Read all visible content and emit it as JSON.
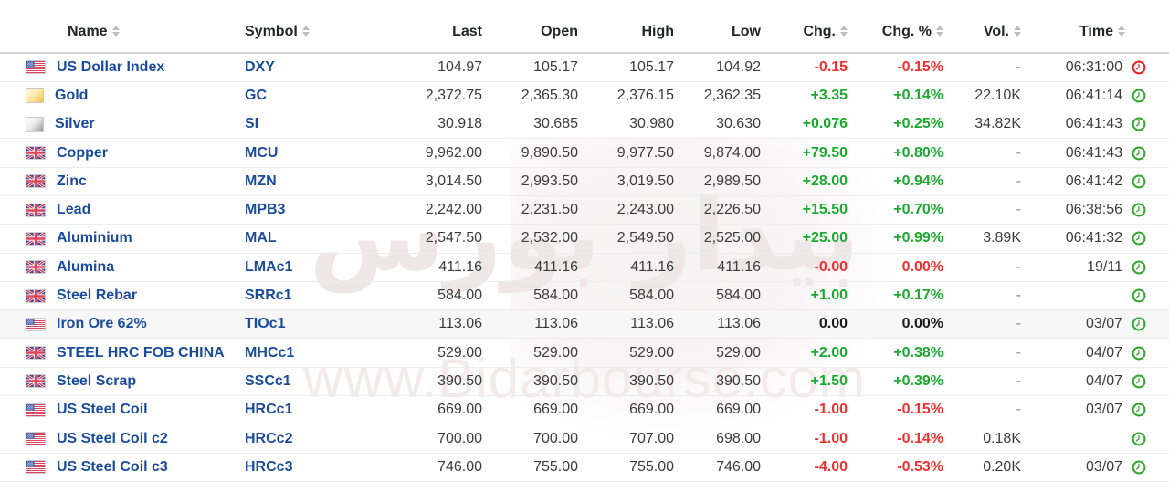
{
  "watermark": {
    "script_text": "بیدار بورس",
    "url_text": "www.Bidarbourse.com"
  },
  "colors": {
    "up": "#19aa2e",
    "down": "#f02f2f",
    "flat": "#1a1a1a",
    "link": "#1a4b9c",
    "header_text": "#232526"
  },
  "table": {
    "columns": [
      {
        "key": "name",
        "label": "Name",
        "align": "left",
        "sortable": true
      },
      {
        "key": "symbol",
        "label": "Symbol",
        "align": "left",
        "sortable": true
      },
      {
        "key": "last",
        "label": "Last",
        "align": "right",
        "sortable": false
      },
      {
        "key": "open",
        "label": "Open",
        "align": "right",
        "sortable": false
      },
      {
        "key": "high",
        "label": "High",
        "align": "right",
        "sortable": false
      },
      {
        "key": "low",
        "label": "Low",
        "align": "right",
        "sortable": false
      },
      {
        "key": "chg",
        "label": "Chg.",
        "align": "right",
        "sortable": true
      },
      {
        "key": "chgpct",
        "label": "Chg. %",
        "align": "right",
        "sortable": true
      },
      {
        "key": "vol",
        "label": "Vol.",
        "align": "right",
        "sortable": true
      },
      {
        "key": "time",
        "label": "Time",
        "align": "right",
        "sortable": true
      }
    ],
    "rows": [
      {
        "icon": "flag-us",
        "name": "US Dollar Index",
        "symbol": "DXY",
        "last": "104.97",
        "open": "105.17",
        "high": "105.17",
        "low": "104.92",
        "chg": "-0.15",
        "chg_dir": "down",
        "chgpct": "-0.15%",
        "chgpct_dir": "down",
        "vol": "-",
        "time": "06:31:00",
        "clock": "clock-red",
        "alt": false
      },
      {
        "icon": "swatch-gold",
        "name": "Gold",
        "symbol": "GC",
        "last": "2,372.75",
        "open": "2,365.30",
        "high": "2,376.15",
        "low": "2,362.35",
        "chg": "+3.35",
        "chg_dir": "up",
        "chgpct": "+0.14%",
        "chgpct_dir": "up",
        "vol": "22.10K",
        "time": "06:41:14",
        "clock": "clock-green",
        "alt": false
      },
      {
        "icon": "swatch-silver",
        "name": "Silver",
        "symbol": "SI",
        "last": "30.918",
        "open": "30.685",
        "high": "30.980",
        "low": "30.630",
        "chg": "+0.076",
        "chg_dir": "up",
        "chgpct": "+0.25%",
        "chgpct_dir": "up",
        "vol": "34.82K",
        "time": "06:41:43",
        "clock": "clock-green",
        "alt": false
      },
      {
        "icon": "flag-uk",
        "name": "Copper",
        "symbol": "MCU",
        "last": "9,962.00",
        "open": "9,890.50",
        "high": "9,977.50",
        "low": "9,874.00",
        "chg": "+79.50",
        "chg_dir": "up",
        "chgpct": "+0.80%",
        "chgpct_dir": "up",
        "vol": "-",
        "time": "06:41:43",
        "clock": "clock-green",
        "alt": false
      },
      {
        "icon": "flag-uk",
        "name": "Zinc",
        "symbol": "MZN",
        "last": "3,014.50",
        "open": "2,993.50",
        "high": "3,019.50",
        "low": "2,989.50",
        "chg": "+28.00",
        "chg_dir": "up",
        "chgpct": "+0.94%",
        "chgpct_dir": "up",
        "vol": "-",
        "time": "06:41:42",
        "clock": "clock-green",
        "alt": false
      },
      {
        "icon": "flag-uk",
        "name": "Lead",
        "symbol": "MPB3",
        "last": "2,242.00",
        "open": "2,231.50",
        "high": "2,243.00",
        "low": "2,226.50",
        "chg": "+15.50",
        "chg_dir": "up",
        "chgpct": "+0.70%",
        "chgpct_dir": "up",
        "vol": "-",
        "time": "06:38:56",
        "clock": "clock-green",
        "alt": false
      },
      {
        "icon": "flag-uk",
        "name": "Aluminium",
        "symbol": "MAL",
        "last": "2,547.50",
        "open": "2,532.00",
        "high": "2,549.50",
        "low": "2,525.00",
        "chg": "+25.00",
        "chg_dir": "up",
        "chgpct": "+0.99%",
        "chgpct_dir": "up",
        "vol": "3.89K",
        "time": "06:41:32",
        "clock": "clock-green",
        "alt": false
      },
      {
        "icon": "flag-uk",
        "name": "Alumina",
        "symbol": "LMAc1",
        "last": "411.16",
        "open": "411.16",
        "high": "411.16",
        "low": "411.16",
        "chg": "-0.00",
        "chg_dir": "down",
        "chgpct": "0.00%",
        "chgpct_dir": "down",
        "vol": "-",
        "time": "19/11",
        "clock": "clock-green",
        "alt": false
      },
      {
        "icon": "flag-uk",
        "name": "Steel Rebar",
        "symbol": "SRRc1",
        "last": "584.00",
        "open": "584.00",
        "high": "584.00",
        "low": "584.00",
        "chg": "+1.00",
        "chg_dir": "up",
        "chgpct": "+0.17%",
        "chgpct_dir": "up",
        "vol": "-",
        "time": "",
        "clock": "clock-green",
        "alt": false
      },
      {
        "icon": "flag-us",
        "name": "Iron Ore 62%",
        "symbol": "TIOc1",
        "last": "113.06",
        "open": "113.06",
        "high": "113.06",
        "low": "113.06",
        "chg": "0.00",
        "chg_dir": "flat",
        "chgpct": "0.00%",
        "chgpct_dir": "flat",
        "vol": "-",
        "time": "03/07",
        "clock": "clock-green",
        "alt": true
      },
      {
        "icon": "flag-uk",
        "name": "STEEL HRC FOB CHINA",
        "symbol": "MHCc1",
        "last": "529.00",
        "open": "529.00",
        "high": "529.00",
        "low": "529.00",
        "chg": "+2.00",
        "chg_dir": "up",
        "chgpct": "+0.38%",
        "chgpct_dir": "up",
        "vol": "-",
        "time": "04/07",
        "clock": "clock-green",
        "alt": false
      },
      {
        "icon": "flag-uk",
        "name": "Steel Scrap",
        "symbol": "SSCc1",
        "last": "390.50",
        "open": "390.50",
        "high": "390.50",
        "low": "390.50",
        "chg": "+1.50",
        "chg_dir": "up",
        "chgpct": "+0.39%",
        "chgpct_dir": "up",
        "vol": "-",
        "time": "04/07",
        "clock": "clock-green",
        "alt": false
      },
      {
        "icon": "flag-us",
        "name": "US Steel Coil",
        "symbol": "HRCc1",
        "last": "669.00",
        "open": "669.00",
        "high": "669.00",
        "low": "669.00",
        "chg": "-1.00",
        "chg_dir": "down",
        "chgpct": "-0.15%",
        "chgpct_dir": "down",
        "vol": "-",
        "time": "03/07",
        "clock": "clock-green",
        "alt": false
      },
      {
        "icon": "flag-us",
        "name": "US Steel Coil c2",
        "symbol": "HRCc2",
        "last": "700.00",
        "open": "700.00",
        "high": "707.00",
        "low": "698.00",
        "chg": "-1.00",
        "chg_dir": "down",
        "chgpct": "-0.14%",
        "chgpct_dir": "down",
        "vol": "0.18K",
        "time": "",
        "clock": "clock-green",
        "alt": false
      },
      {
        "icon": "flag-us",
        "name": "US Steel Coil c3",
        "symbol": "HRCc3",
        "last": "746.00",
        "open": "755.00",
        "high": "755.00",
        "low": "746.00",
        "chg": "-4.00",
        "chg_dir": "down",
        "chgpct": "-0.53%",
        "chgpct_dir": "down",
        "vol": "0.20K",
        "time": "03/07",
        "clock": "clock-green",
        "alt": false
      }
    ]
  }
}
